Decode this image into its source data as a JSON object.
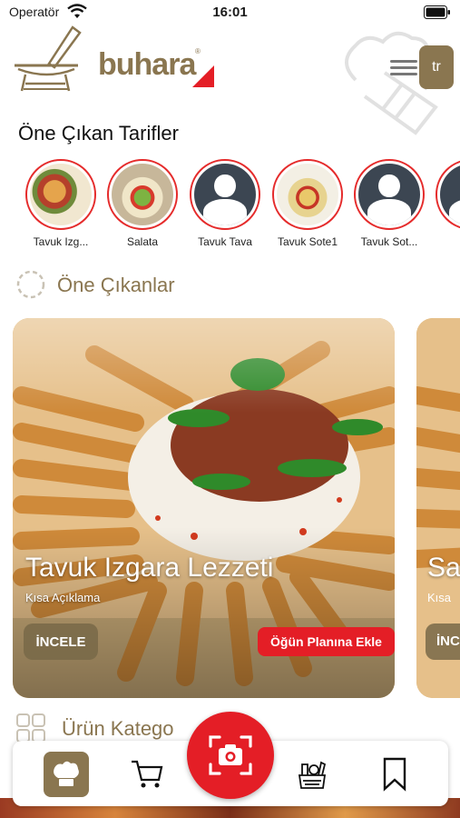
{
  "status_bar": {
    "carrier": "Operatör",
    "time": "16:01"
  },
  "header": {
    "logo_text": "buhara",
    "logo_reg": "®",
    "language": "tr"
  },
  "featured_recipes": {
    "title": "Öne Çıkan Tarifler",
    "items": [
      {
        "label": "Tavuk Izg...",
        "image": "food-photo"
      },
      {
        "label": "Salata",
        "image": "food-photo"
      },
      {
        "label": "Tavuk Tava",
        "image": "default-avatar"
      },
      {
        "label": "Tavuk Sote1",
        "image": "food-photo"
      },
      {
        "label": "Tavuk Sot...",
        "image": "default-avatar"
      }
    ]
  },
  "highlights": {
    "title": "Öne Çıkanlar",
    "cards": [
      {
        "title": "Tavuk Izgara Lezzeti",
        "description": "Kısa Açıklama",
        "inspect_label": "İNCELE",
        "plan_label": "Öğün Planına Ekle"
      },
      {
        "title": "Sa",
        "description": "Kısa",
        "inspect_label": "İNC"
      }
    ]
  },
  "categories": {
    "title": "Ürün Katego"
  },
  "tabbar": {
    "items": [
      {
        "icon": "chef-hat-icon",
        "active": true
      },
      {
        "icon": "cart-icon",
        "active": false
      },
      {
        "icon": "camera-scan-icon",
        "active": false
      },
      {
        "icon": "groceries-icon",
        "active": false
      },
      {
        "icon": "bookmark-icon",
        "active": false
      }
    ]
  },
  "colors": {
    "brand": "#8a7650",
    "accent": "#e41e26",
    "story_ring": "#e52b2b"
  }
}
